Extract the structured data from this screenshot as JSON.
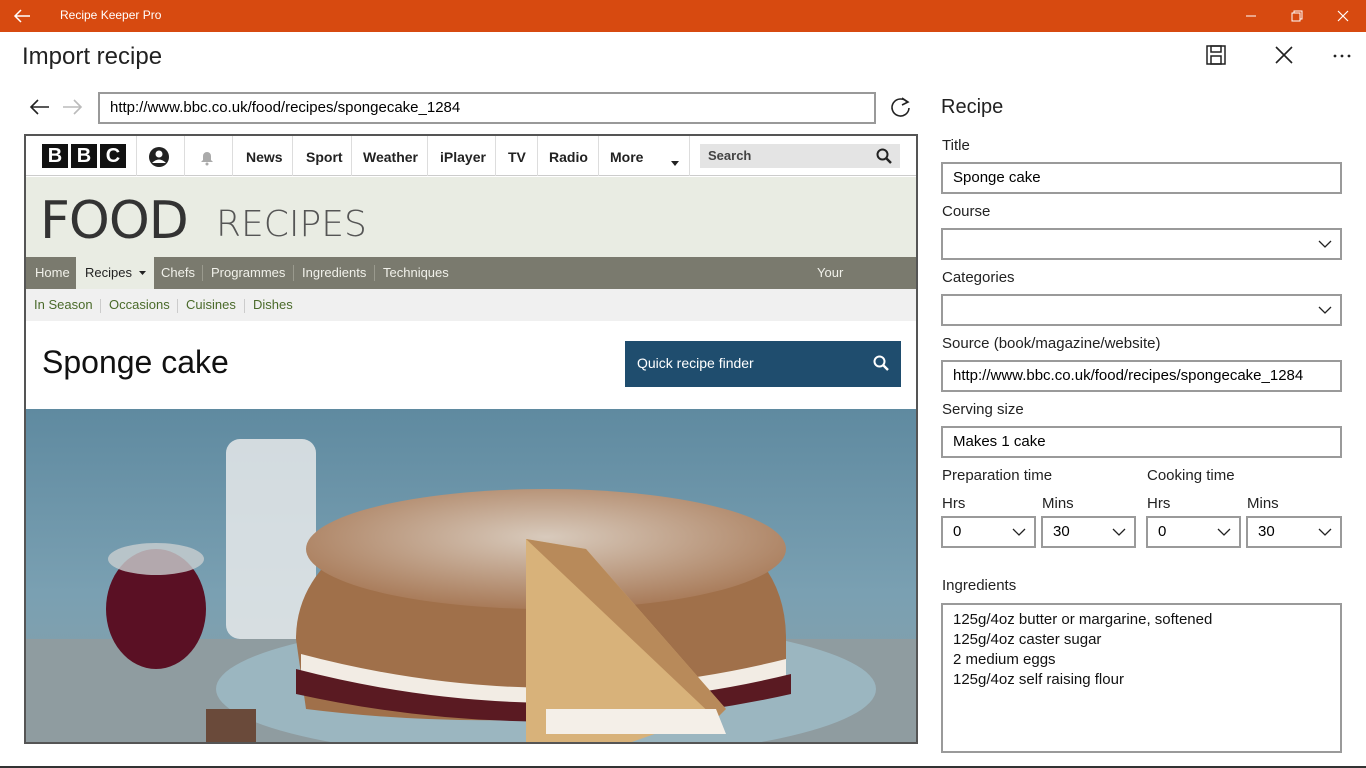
{
  "window": {
    "title": "Recipe Keeper Pro",
    "accent": "#d74a10"
  },
  "page": {
    "title": "Import recipe"
  },
  "browser": {
    "url": "http://www.bbc.co.uk/food/recipes/spongecake_1284"
  },
  "bbc": {
    "logo": [
      "B",
      "B",
      "C"
    ],
    "nav": [
      "News",
      "Sport",
      "Weather",
      "iPlayer",
      "TV",
      "Radio",
      "More"
    ],
    "search_placeholder": "Search",
    "food_word": "FOOD",
    "recipes_word": "RECIPES",
    "main_nav": [
      "Home",
      "Recipes",
      "Chefs",
      "Programmes",
      "Ingredients",
      "Techniques"
    ],
    "favourites": "Your Favourites",
    "sub_nav": [
      "In Season",
      "Occasions",
      "Cuisines",
      "Dishes"
    ],
    "recipe_title": "Sponge cake",
    "finder_label": "Quick recipe finder"
  },
  "form": {
    "heading": "Recipe",
    "title_label": "Title",
    "title_value": "Sponge cake",
    "course_label": "Course",
    "course_value": "",
    "categories_label": "Categories",
    "categories_value": "",
    "source_label": "Source (book/magazine/website)",
    "source_value": "http://www.bbc.co.uk/food/recipes/spongecake_1284",
    "serving_label": "Serving size",
    "serving_value": "Makes 1 cake",
    "prep_label": "Preparation time",
    "cook_label": "Cooking time",
    "hrs_label": "Hrs",
    "mins_label": "Mins",
    "prep_hrs": "0",
    "prep_mins": "30",
    "cook_hrs": "0",
    "cook_mins": "30",
    "ingredients_label": "Ingredients",
    "ingredients": [
      "125g/4oz butter or margarine, softened",
      "125g/4oz caster sugar",
      "2 medium eggs",
      "125g/4oz self raising flour"
    ]
  }
}
